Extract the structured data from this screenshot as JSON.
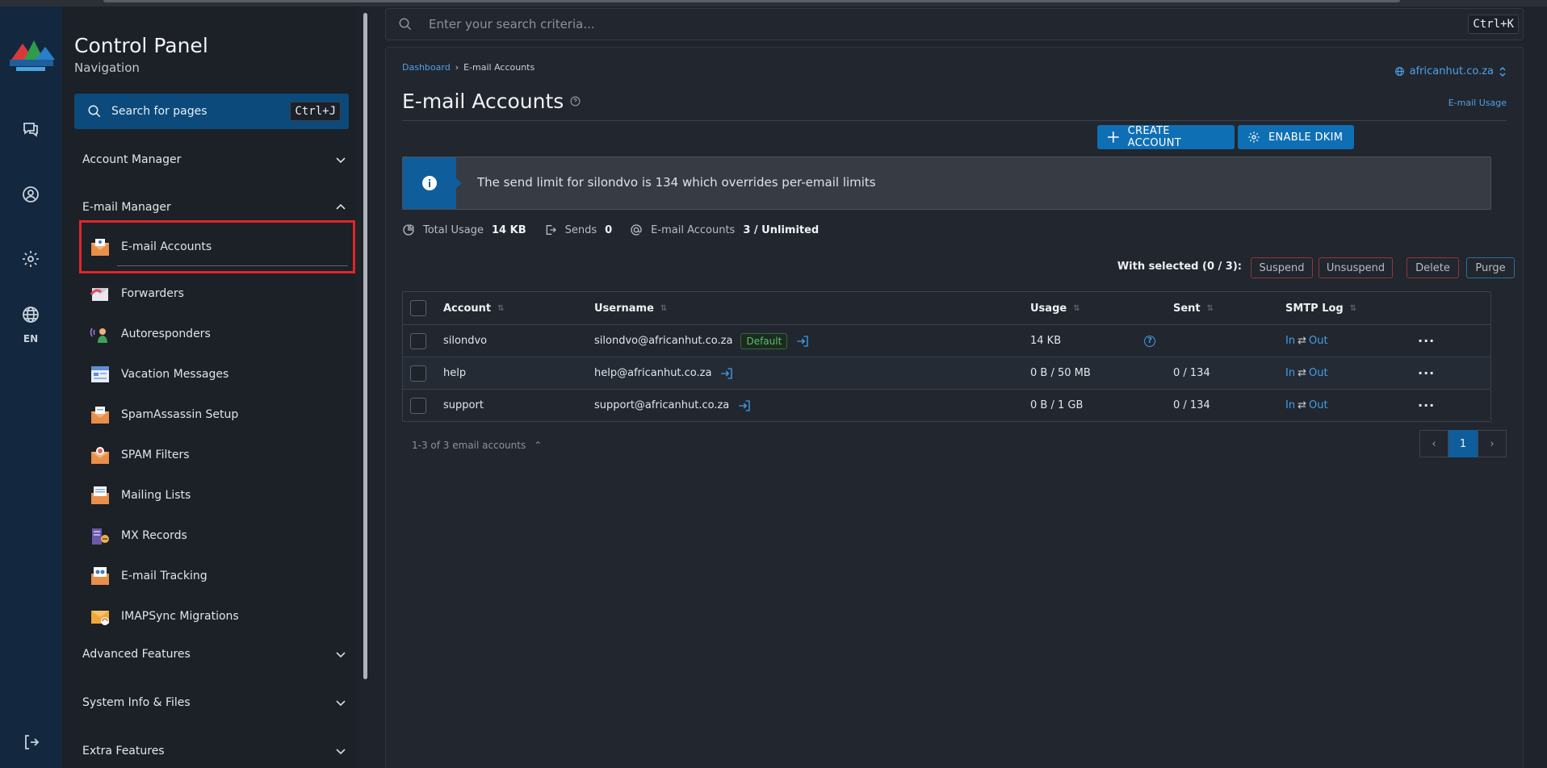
{
  "nav": {
    "title": "Control Panel",
    "subtitle": "Navigation",
    "search_label": "Search for pages",
    "search_shortcut": "Ctrl+J",
    "language": "EN",
    "sections": {
      "account_manager": "Account Manager",
      "email_manager": "E-mail Manager",
      "advanced_features": "Advanced Features",
      "system_info": "System Info & Files",
      "extra_features": "Extra Features"
    },
    "items": [
      {
        "label": "E-mail Accounts"
      },
      {
        "label": "Forwarders"
      },
      {
        "label": "Autoresponders"
      },
      {
        "label": "Vacation Messages"
      },
      {
        "label": "SpamAssassin Setup"
      },
      {
        "label": "SPAM Filters"
      },
      {
        "label": "Mailing Lists"
      },
      {
        "label": "MX Records"
      },
      {
        "label": "E-mail Tracking"
      },
      {
        "label": "IMAPSync Migrations"
      }
    ]
  },
  "topsearch": {
    "placeholder": "Enter your search criteria...",
    "shortcut": "Ctrl+K"
  },
  "main": {
    "breadcrumb": [
      "Dashboard",
      "E-mail Accounts"
    ],
    "domain": "africanhut.co.za",
    "title": "E-mail Accounts",
    "usage_link": "E-mail Usage",
    "create_btn": "CREATE ACCOUNT",
    "dkim_btn": "ENABLE DKIM",
    "alert": "The send limit for silondvo is 134 which overrides per-email limits",
    "stats": {
      "total_usage_label": "Total Usage",
      "total_usage": "14 KB",
      "sends_label": "Sends",
      "sends": "0",
      "accounts_label": "E-mail Accounts",
      "accounts": "3 / Unlimited"
    },
    "with_selected": "With selected (0 / 3):",
    "actions": {
      "suspend": "Suspend",
      "unsuspend": "Unsuspend",
      "delete": "Delete",
      "purge": "Purge"
    },
    "columns": [
      "Account",
      "Username",
      "Usage",
      "Sent",
      "SMTP Log"
    ],
    "rows": [
      {
        "account": "silondvo",
        "username": "silondvo@africanhut.co.za",
        "badge": "Default",
        "usage": "14 KB",
        "sent": "",
        "in": "In",
        "out": "Out"
      },
      {
        "account": "help",
        "username": "help@africanhut.co.za",
        "usage": "0 B / 50 MB",
        "sent": "0 / 134",
        "in": "In",
        "out": "Out"
      },
      {
        "account": "support",
        "username": "support@africanhut.co.za",
        "usage": "0 B / 1 GB",
        "sent": "0 / 134",
        "in": "In",
        "out": "Out"
      }
    ],
    "footer_count": "1-3 of 3 email accounts",
    "current_page": "1"
  },
  "colors": {
    "accent": "#0f6fb4",
    "link": "#4da3e8",
    "highlight": "#e0262a",
    "default_badge": "#54c06a"
  }
}
